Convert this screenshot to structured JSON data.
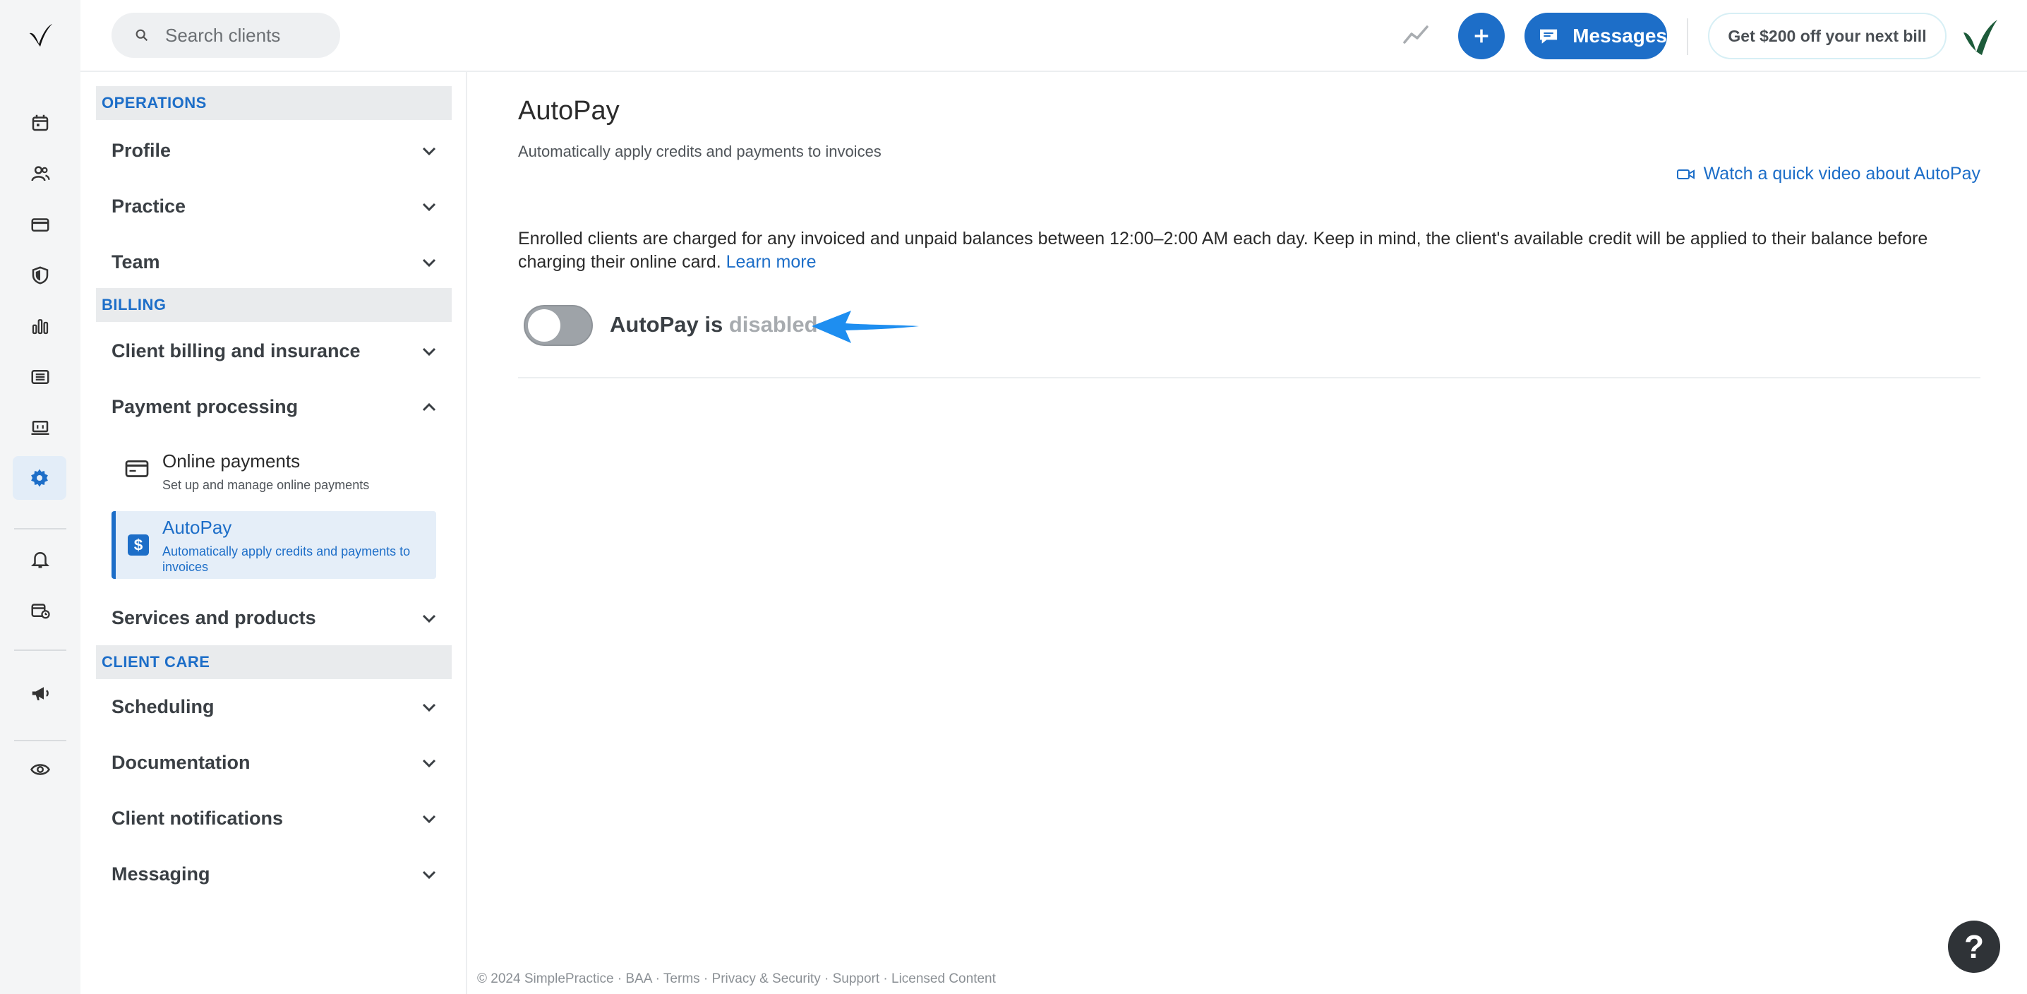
{
  "search": {
    "placeholder": "Search clients"
  },
  "topbar": {
    "messages_label": "Messages",
    "promo_label": "Get $200 off your next bill"
  },
  "settings_nav": {
    "sections": [
      {
        "heading": "OPERATIONS",
        "items": [
          "Profile",
          "Practice",
          "Team"
        ]
      },
      {
        "heading": "BILLING",
        "items": [
          "Client billing and insurance",
          "Payment processing",
          "Services and products"
        ]
      },
      {
        "heading": "CLIENT CARE",
        "items": [
          "Scheduling",
          "Documentation",
          "Client notifications",
          "Messaging"
        ]
      }
    ],
    "payment_sub": [
      {
        "title": "Online payments",
        "desc": "Set up and manage online payments",
        "icon": "card-icon"
      },
      {
        "title": "AutoPay",
        "desc": "Automatically apply credits and payments to invoices",
        "icon": "dollar-icon"
      }
    ]
  },
  "main": {
    "title": "AutoPay",
    "subtitle": "Automatically apply credits and payments to invoices",
    "video_link": "Watch a quick video about AutoPay",
    "description": "Enrolled clients are charged for any invoiced and unpaid balances between 12:00–2:00 AM each day. Keep in mind, the client's available credit will be applied to their balance before charging their online card.",
    "learn_more": "Learn more",
    "toggle_prefix": "AutoPay is",
    "toggle_state": "disabled"
  },
  "footer": {
    "text": "© 2024 SimplePractice · BAA · Terms · Privacy & Security · Support · Licensed Content"
  },
  "help": {
    "label": "?"
  },
  "colors": {
    "accent": "#1d6ec8",
    "toggle_off": "#9ea3a8",
    "arrow": "#1e8ef0"
  }
}
